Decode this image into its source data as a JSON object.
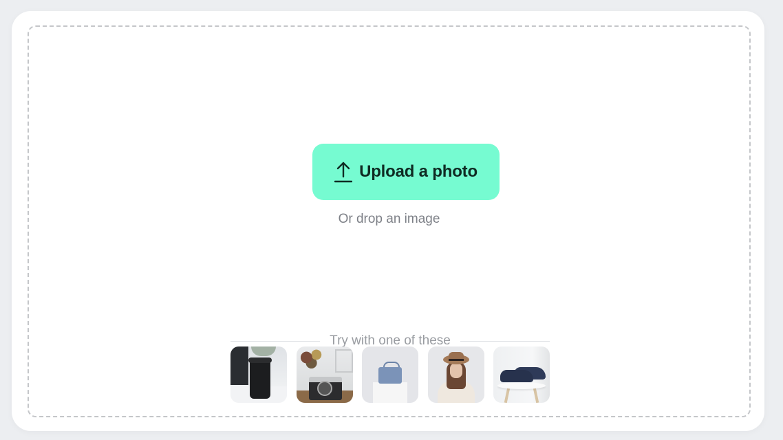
{
  "upload": {
    "button_label": "Upload a photo",
    "icon": "upload-arrow-icon",
    "drop_hint": "Or drop an image"
  },
  "samples": {
    "heading": "Try with one of these",
    "items": [
      {
        "name": "coffee-cup",
        "alt": "Black coffee tumbler on desk"
      },
      {
        "name": "camera",
        "alt": "Vintage camera with dried flowers"
      },
      {
        "name": "handbag",
        "alt": "Blue handbag on pedestal"
      },
      {
        "name": "woman-hat",
        "alt": "Woman wearing a straw hat"
      },
      {
        "name": "shoes",
        "alt": "Navy leather shoes on stool"
      }
    ]
  },
  "colors": {
    "accent": "#76fbd1",
    "button_text": "#0f2b23",
    "background": "#eceef1"
  }
}
